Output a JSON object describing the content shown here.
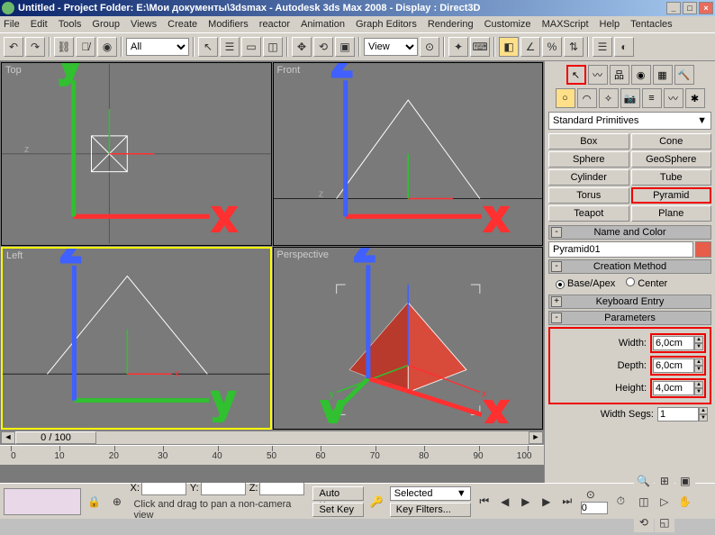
{
  "title": "Untitled    - Project Folder: E:\\Мои документы\\3dsmax    - Autodesk 3ds Max 2008    - Display : Direct3D",
  "menu": [
    "File",
    "Edit",
    "Tools",
    "Group",
    "Views",
    "Create",
    "Modifiers",
    "reactor",
    "Animation",
    "Graph Editors",
    "Rendering",
    "Customize",
    "MAXScript",
    "Help",
    "Tentacles"
  ],
  "toolbar": {
    "selection_filter": "All",
    "reference_mode": "View"
  },
  "viewports": {
    "top": "Top",
    "front": "Front",
    "left": "Left",
    "perspective": "Perspective"
  },
  "frame_indicator": "0 / 100",
  "timeline_ticks": [
    0,
    10,
    20,
    30,
    40,
    50,
    60,
    70,
    80,
    90,
    100
  ],
  "side": {
    "category": "Standard Primitives",
    "primitives": [
      "Box",
      "Cone",
      "Sphere",
      "GeoSphere",
      "Cylinder",
      "Tube",
      "Torus",
      "Pyramid",
      "Teapot",
      "Plane"
    ],
    "rollout_name": "Name and Color",
    "object_name": "Pyramid01",
    "rollout_creation": "Creation Method",
    "creation_opts": {
      "a": "Base/Apex",
      "b": "Center"
    },
    "rollout_kb": "Keyboard Entry",
    "rollout_params": "Parameters",
    "params": {
      "width_label": "Width:",
      "width": "6,0cm",
      "depth_label": "Depth:",
      "depth": "6,0cm",
      "height_label": "Height:",
      "height": "4,0cm",
      "wsegs_label": "Width Segs:",
      "wsegs": "1"
    }
  },
  "bottom": {
    "coords": {
      "x": "X:",
      "y": "Y:",
      "z": "Z:"
    },
    "auto_key": "Auto Key",
    "set_key": "Set Key",
    "selected": "Selected",
    "key_filters": "Key Filters...",
    "cur_frame": "0",
    "prompt": "Click and drag to pan a non-camera view"
  }
}
